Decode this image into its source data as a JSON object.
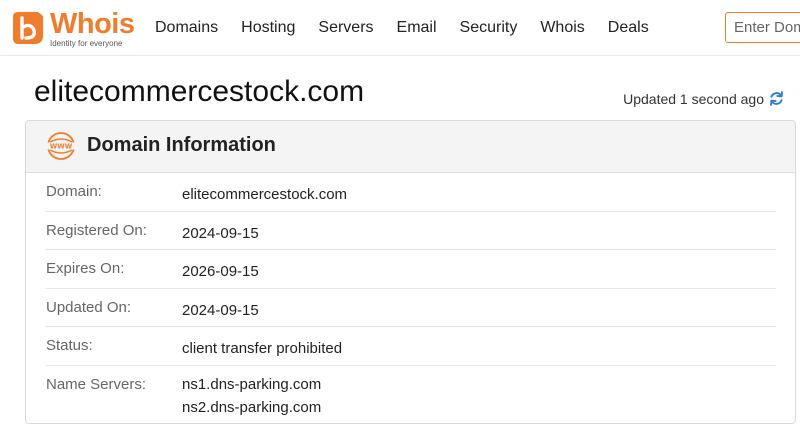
{
  "header": {
    "logo": {
      "word": "Whois",
      "tagline": "Identity for everyone"
    },
    "nav": [
      "Domains",
      "Hosting",
      "Servers",
      "Email",
      "Security",
      "Whois",
      "Deals"
    ],
    "search": {
      "placeholder": "Enter Domain",
      "value": ""
    }
  },
  "page": {
    "title": "elitecommercestock.com",
    "updated": "Updated 1 second ago"
  },
  "card": {
    "title": "Domain Information",
    "rows": [
      {
        "label": "Domain:",
        "value": "elitecommercestock.com"
      },
      {
        "label": "Registered On:",
        "value": "2024-09-15"
      },
      {
        "label": "Expires On:",
        "value": "2026-09-15"
      },
      {
        "label": "Updated On:",
        "value": "2024-09-15"
      },
      {
        "label": "Status:",
        "value": "client transfer prohibited"
      },
      {
        "label": "Name Servers:",
        "values": [
          "ns1.dns-parking.com",
          "ns2.dns-parking.com"
        ]
      }
    ]
  },
  "colors": {
    "accent": "#ef7d2d",
    "refresh": "#2b7bd9"
  }
}
